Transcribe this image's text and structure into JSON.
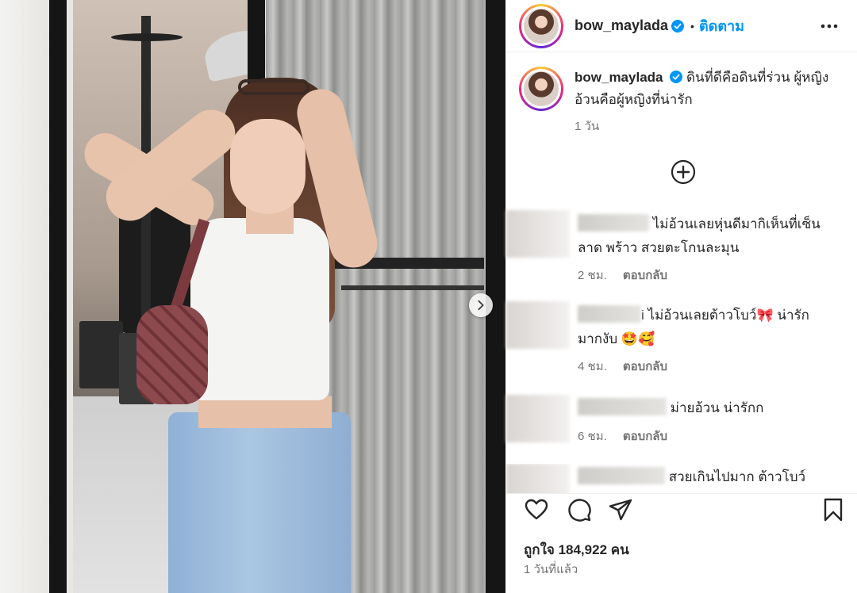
{
  "post": {
    "username": "bow_maylada",
    "follow_label": "ติดตาม",
    "separator": "•",
    "caption": "ดินที่ดีคือดินที่ร่วน ผู้หญิงอ้วนคือผู้หญิงที่น่ารัก",
    "caption_time": "1 วัน",
    "likes": "ถูกใจ 184,922 คน",
    "posted_time": "1 วันที่แล้ว"
  },
  "comments": [
    {
      "text": "ไม่อ้วนเลยหุ่นดีมากิเห็นที่เซ็นลาด พร้าว สวยตะโกนละมุน",
      "time": "2 ชม.",
      "reply": "ตอบกลับ"
    },
    {
      "partial_name": "i",
      "text": "ไม่อ้วนเลยต้าวโบว์",
      "text_end": "น่ารัก",
      "text2": "มากงับ",
      "time": "4 ชม.",
      "reply": "ตอบกลับ"
    },
    {
      "text": "ม่ายอ้วน น่ารักก",
      "time": "6 ชม.",
      "reply": "ตอบกลับ"
    },
    {
      "text": "สวยเกินไปมาก ต้าวโบว์"
    }
  ],
  "icons": {
    "verified": "verified-badge-icon",
    "more": "more-options-icon",
    "add": "add-circle-icon",
    "like": "heart-icon",
    "comment": "comment-bubble-icon",
    "share": "paper-plane-icon",
    "save": "bookmark-icon",
    "next": "chevron-right-icon"
  },
  "colors": {
    "link": "#0095f6",
    "verified": "#0095f6",
    "text": "#262626",
    "muted": "#737373"
  }
}
